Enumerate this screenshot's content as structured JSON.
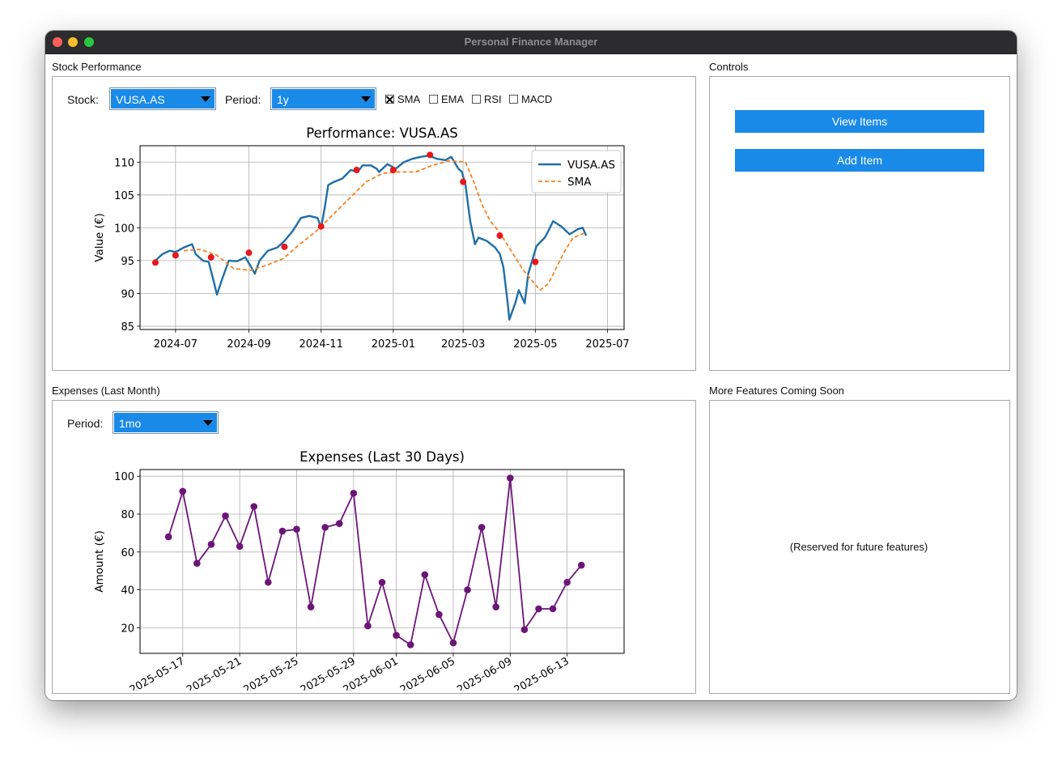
{
  "window": {
    "title": "Personal Finance Manager"
  },
  "stock_panel": {
    "label": "Stock Performance",
    "stock_label": "Stock:",
    "stock_value": "VUSA.AS",
    "period_label": "Period:",
    "period_value": "1y",
    "indicators": [
      {
        "label": "SMA",
        "checked": true
      },
      {
        "label": "EMA",
        "checked": false
      },
      {
        "label": "RSI",
        "checked": false
      },
      {
        "label": "MACD",
        "checked": false
      }
    ]
  },
  "controls_panel": {
    "label": "Controls",
    "view_items": "View Items",
    "add_item": "Add Item"
  },
  "expenses_panel": {
    "label": "Expenses (Last Month)",
    "period_label": "Period:",
    "period_value": "1mo"
  },
  "future_panel": {
    "label": "More Features Coming Soon",
    "note": "(Reserved for future features)"
  },
  "colors": {
    "accent": "#1a8ae8",
    "price_line": "#1f6fa8",
    "sma_line": "#f58220",
    "markers": "#e8161b",
    "expense_line": "#6c1578"
  },
  "chart_data": [
    {
      "type": "line",
      "title": "Performance: VUSA.AS",
      "xlabel": "",
      "ylabel": "Value (€)",
      "x_ticks": [
        "2024-07",
        "2024-09",
        "2024-11",
        "2025-01",
        "2025-03",
        "2025-05",
        "2025-07"
      ],
      "y_ticks": [
        85,
        90,
        95,
        100,
        105,
        110
      ],
      "xlim": [
        "2024-06-01",
        "2025-07-15"
      ],
      "ylim": [
        84.5,
        112.5
      ],
      "grid": true,
      "legend": "top-right",
      "series": [
        {
          "name": "VUSA.AS",
          "style": "solid",
          "x": [
            "2024-06-14",
            "2024-06-20",
            "2024-06-26",
            "2024-07-01",
            "2024-07-08",
            "2024-07-15",
            "2024-07-18",
            "2024-07-24",
            "2024-07-29",
            "2024-08-02",
            "2024-08-05",
            "2024-08-09",
            "2024-08-15",
            "2024-08-22",
            "2024-08-29",
            "2024-09-03",
            "2024-09-06",
            "2024-09-10",
            "2024-09-17",
            "2024-09-25",
            "2024-10-01",
            "2024-10-08",
            "2024-10-15",
            "2024-10-22",
            "2024-10-29",
            "2024-11-01",
            "2024-11-04",
            "2024-11-07",
            "2024-11-12",
            "2024-11-19",
            "2024-11-26",
            "2024-12-02",
            "2024-12-06",
            "2024-12-13",
            "2024-12-18",
            "2024-12-20",
            "2024-12-27",
            "2025-01-03",
            "2025-01-10",
            "2025-01-17",
            "2025-01-24",
            "2025-01-31",
            "2025-02-07",
            "2025-02-14",
            "2025-02-19",
            "2025-02-25",
            "2025-02-28",
            "2025-03-03",
            "2025-03-07",
            "2025-03-11",
            "2025-03-14",
            "2025-03-21",
            "2025-03-28",
            "2025-04-01",
            "2025-04-04",
            "2025-04-08",
            "2025-04-09",
            "2025-04-14",
            "2025-04-17",
            "2025-04-22",
            "2025-04-25",
            "2025-05-02",
            "2025-05-09",
            "2025-05-12",
            "2025-05-16",
            "2025-05-23",
            "2025-05-30",
            "2025-06-06",
            "2025-06-10",
            "2025-06-13"
          ],
          "y": [
            95,
            96,
            96.5,
            96.3,
            97,
            97.5,
            96,
            95,
            94.8,
            92,
            89.8,
            92,
            95,
            94.9,
            95.5,
            94,
            93,
            95,
            96.5,
            97,
            98,
            99.5,
            101.5,
            101.8,
            101.5,
            100,
            103,
            106.5,
            107,
            107.5,
            108.8,
            108.5,
            109.5,
            109.5,
            109,
            108.5,
            109.7,
            109,
            110,
            110.5,
            110.8,
            111,
            110.5,
            110.3,
            110.8,
            109,
            108.5,
            106.5,
            101,
            97.5,
            98.5,
            98,
            97,
            96,
            94,
            88,
            86,
            88.5,
            90.5,
            88.5,
            93,
            97.2,
            98.5,
            99.5,
            101,
            100.2,
            99,
            99.8,
            100,
            98.8
          ]
        },
        {
          "name": "SMA",
          "style": "dashed",
          "x": [
            "2024-07-08",
            "2024-07-22",
            "2024-08-05",
            "2024-08-19",
            "2024-09-02",
            "2024-09-16",
            "2024-09-30",
            "2024-10-14",
            "2024-10-28",
            "2024-11-11",
            "2024-11-25",
            "2024-12-09",
            "2024-12-23",
            "2025-01-06",
            "2025-01-20",
            "2025-02-03",
            "2025-02-17",
            "2025-03-03",
            "2025-03-10",
            "2025-03-17",
            "2025-03-24",
            "2025-03-31",
            "2025-04-07",
            "2025-04-14",
            "2025-04-21",
            "2025-04-28",
            "2025-05-05",
            "2025-05-12",
            "2025-05-19",
            "2025-05-26",
            "2025-06-02",
            "2025-06-13"
          ],
          "y": [
            96.5,
            96.7,
            95.8,
            93.8,
            93.5,
            94.3,
            95.3,
            97.5,
            99.5,
            102,
            104.5,
            107,
            108.3,
            108.5,
            108.5,
            109.5,
            110.2,
            110,
            107,
            103.5,
            101,
            99.5,
            97.5,
            95.5,
            93.5,
            92,
            90.5,
            91.5,
            94,
            96.5,
            98.5,
            99.3
          ]
        }
      ],
      "markers": [
        {
          "x": "2024-06-14",
          "y": 94.7
        },
        {
          "x": "2024-07-01",
          "y": 95.8
        },
        {
          "x": "2024-07-31",
          "y": 95.5
        },
        {
          "x": "2024-09-01",
          "y": 96.2
        },
        {
          "x": "2024-10-01",
          "y": 97.1
        },
        {
          "x": "2024-11-01",
          "y": 100.2
        },
        {
          "x": "2024-12-01",
          "y": 108.8
        },
        {
          "x": "2025-01-01",
          "y": 108.8
        },
        {
          "x": "2025-02-01",
          "y": 111.1
        },
        {
          "x": "2025-03-01",
          "y": 107
        },
        {
          "x": "2025-04-01",
          "y": 98.8
        },
        {
          "x": "2025-05-01",
          "y": 94.8
        }
      ]
    },
    {
      "type": "line",
      "title": "Expenses (Last 30 Days)",
      "xlabel": "",
      "ylabel": "Amount (€)",
      "x_ticks": [
        "2025-05-17",
        "2025-05-21",
        "2025-05-25",
        "2025-05-29",
        "2025-06-01",
        "2025-06-05",
        "2025-06-09",
        "2025-06-13"
      ],
      "y_ticks": [
        20,
        40,
        60,
        80,
        100
      ],
      "xlim": [
        "2025-05-14",
        "2025-06-17"
      ],
      "ylim": [
        6.5,
        103.5
      ],
      "grid": true,
      "series": [
        {
          "x": [
            "2025-05-16",
            "2025-05-17",
            "2025-05-18",
            "2025-05-19",
            "2025-05-20",
            "2025-05-21",
            "2025-05-22",
            "2025-05-23",
            "2025-05-24",
            "2025-05-25",
            "2025-05-26",
            "2025-05-27",
            "2025-05-28",
            "2025-05-29",
            "2025-05-30",
            "2025-05-31",
            "2025-06-01",
            "2025-06-02",
            "2025-06-03",
            "2025-06-04",
            "2025-06-05",
            "2025-06-06",
            "2025-06-07",
            "2025-06-08",
            "2025-06-09",
            "2025-06-10",
            "2025-06-11",
            "2025-06-12",
            "2025-06-13",
            "2025-06-14"
          ],
          "y": [
            68,
            92,
            54,
            64,
            79,
            63,
            84,
            44,
            71,
            72,
            31,
            73,
            75,
            91,
            21,
            44,
            16,
            11,
            48,
            27,
            12,
            40,
            73,
            31,
            99,
            19,
            30,
            30,
            44,
            53
          ]
        }
      ]
    }
  ]
}
